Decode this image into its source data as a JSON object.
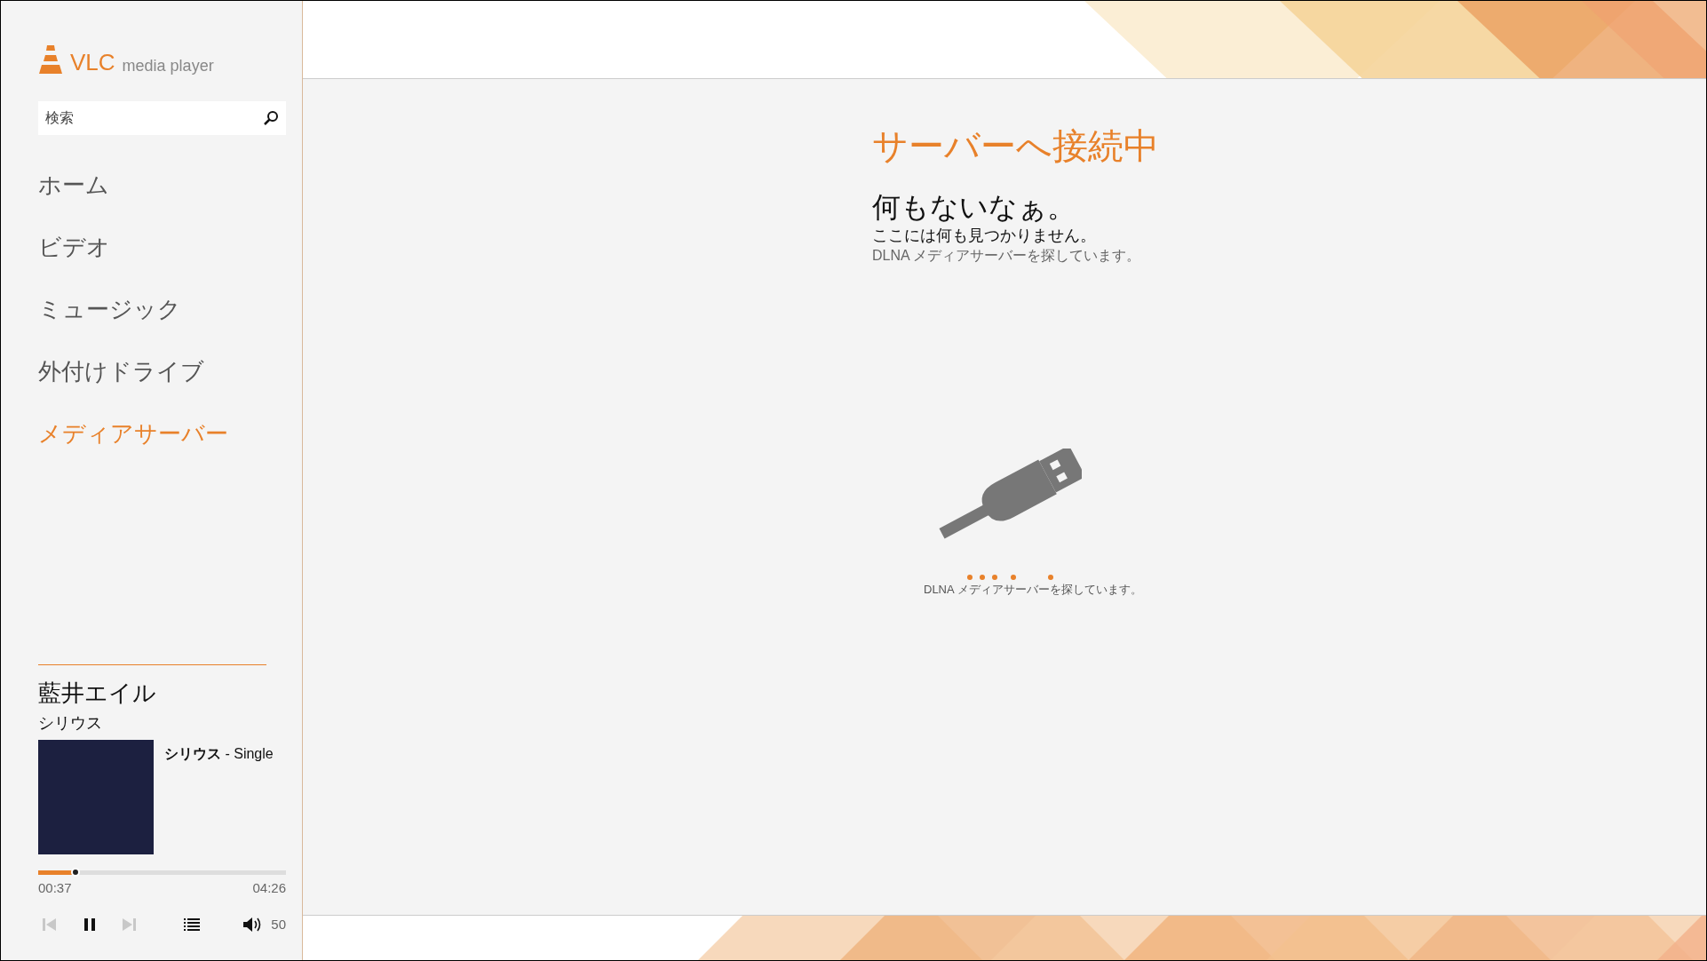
{
  "logo": {
    "brand": "VLC",
    "subtitle": "media player"
  },
  "search": {
    "placeholder": "検索"
  },
  "nav": [
    {
      "label": "ホーム",
      "selected": false
    },
    {
      "label": "ビデオ",
      "selected": false
    },
    {
      "label": "ミュージック",
      "selected": false
    },
    {
      "label": "外付けドライブ",
      "selected": false
    },
    {
      "label": "メディアサーバー",
      "selected": true
    }
  ],
  "now_playing": {
    "artist": "藍井エイル",
    "track": "シリウス",
    "album": "**シリウス** - Single",
    "progress": {
      "level": 0.14,
      "elapsed": "00:37",
      "duration": "04:26"
    },
    "controls": [
      {
        "kind": "previous",
        "disabled": true
      },
      {
        "kind": "pause",
        "disabled": false
      },
      {
        "kind": "next",
        "disabled": true
      },
      {
        "kind": "playlist",
        "disabled": false
      }
    ],
    "volume": "50"
  },
  "main": {
    "title": "サーバーへ接続中",
    "heading": "何もないなぁ。",
    "message": "ここには何も見つかりません。",
    "detail": "DLNA メディアサーバーを探しています。",
    "loading_text": "DLNA メディアサーバーを探しています。"
  }
}
